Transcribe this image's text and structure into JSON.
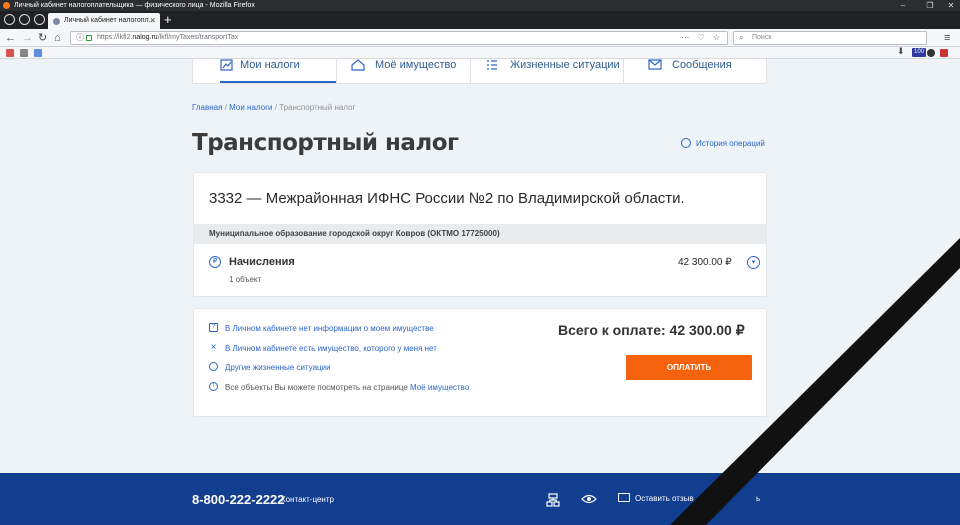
{
  "window": {
    "title": "Личный кабинет налогоплательщика — физического лица - Mozilla Firefox"
  },
  "browser": {
    "tab_title": "Личный кабинет налогопл...",
    "url_prefix": "https://lkfl2.",
    "url_host": "nalog.ru",
    "url_path": "/lkfl/myTaxes/transportTax",
    "search_placeholder": "Поиск",
    "bookmark_badge": "100"
  },
  "nav": {
    "items": [
      {
        "label": "Мои налоги",
        "icon": "pie-chart-icon",
        "active": true
      },
      {
        "label": "Моё имущество",
        "icon": "property-icon",
        "active": false
      },
      {
        "label": "Жизненные ситуации",
        "icon": "list-icon",
        "active": false
      },
      {
        "label": "Сообщения",
        "icon": "envelope-icon",
        "active": false
      }
    ]
  },
  "breadcrumb": {
    "home": "Главная",
    "separator": " / ",
    "taxes": "Мои налоги",
    "current": "Транспортный налог"
  },
  "page": {
    "title": "Транспортный налог",
    "history_link": "История операций"
  },
  "tax_card": {
    "inspection": "3332 — Межрайонная ИФНС России №2 по Владимирской области.",
    "municipality": "Муниципальное образование городской округ Ковров (ОКТМО 17725000)",
    "accruals_label": "Начисления",
    "accruals_sub": "1 объект",
    "accruals_amount": "42 300.00 ₽",
    "ruble_symbol": "₽"
  },
  "summary": {
    "links": [
      {
        "icon": "question-icon",
        "glyph": "?",
        "text": "В Личном кабинете нет информации о моем имуществе"
      },
      {
        "icon": "close-icon",
        "glyph": "×",
        "text": "В Личном кабинете есть имущество, которого у меня нет"
      },
      {
        "icon": "circle-icon",
        "glyph": "",
        "text": "Другие жизненные ситуации"
      }
    ],
    "info_text": "Все объекты Вы можете посмотреть на странице ",
    "info_link": "Моё имущество",
    "total_label": "Всего к оплате: 42 300.00 ₽",
    "pay_button": "ОПЛАТИТЬ"
  },
  "footer": {
    "phone": "8-800-222-2222",
    "contact_center": "Контакт-центр",
    "feedback": "Оставить отзыв",
    "extra": "ь"
  },
  "colors": {
    "accent": "#2c66c9",
    "pay_button": "#f5620d",
    "footer": "#123e8f",
    "ribbon": "#111111"
  }
}
